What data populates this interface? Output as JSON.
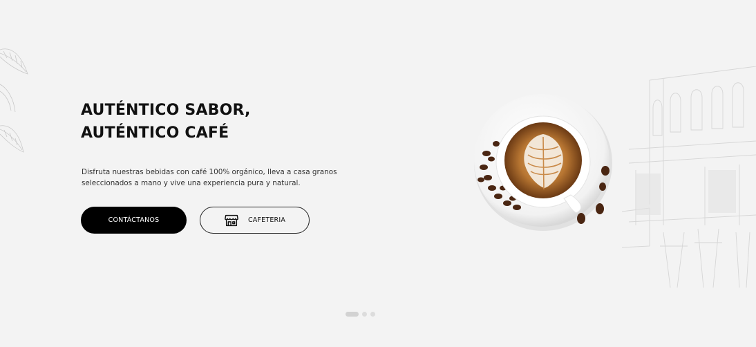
{
  "hero": {
    "title_line1": "AUTÉNTICO SABOR,",
    "title_line2": "AUTÉNTICO CAFÉ",
    "description": "Disfruta nuestras bebidas con café 100% orgánico, lleva a casa granos seleccionados a mano y vive una experiencia pura y natural.",
    "primary_button": "CONTÁCTANOS",
    "secondary_button": "CAFETERIA",
    "secondary_button_icon": "store-icon",
    "image": "coffee-cup-latte-art"
  },
  "carousel": {
    "slides": 3,
    "active": 1
  },
  "colors": {
    "background": "#f3f3f3",
    "primary_button": "#000000",
    "text": "#111111"
  }
}
